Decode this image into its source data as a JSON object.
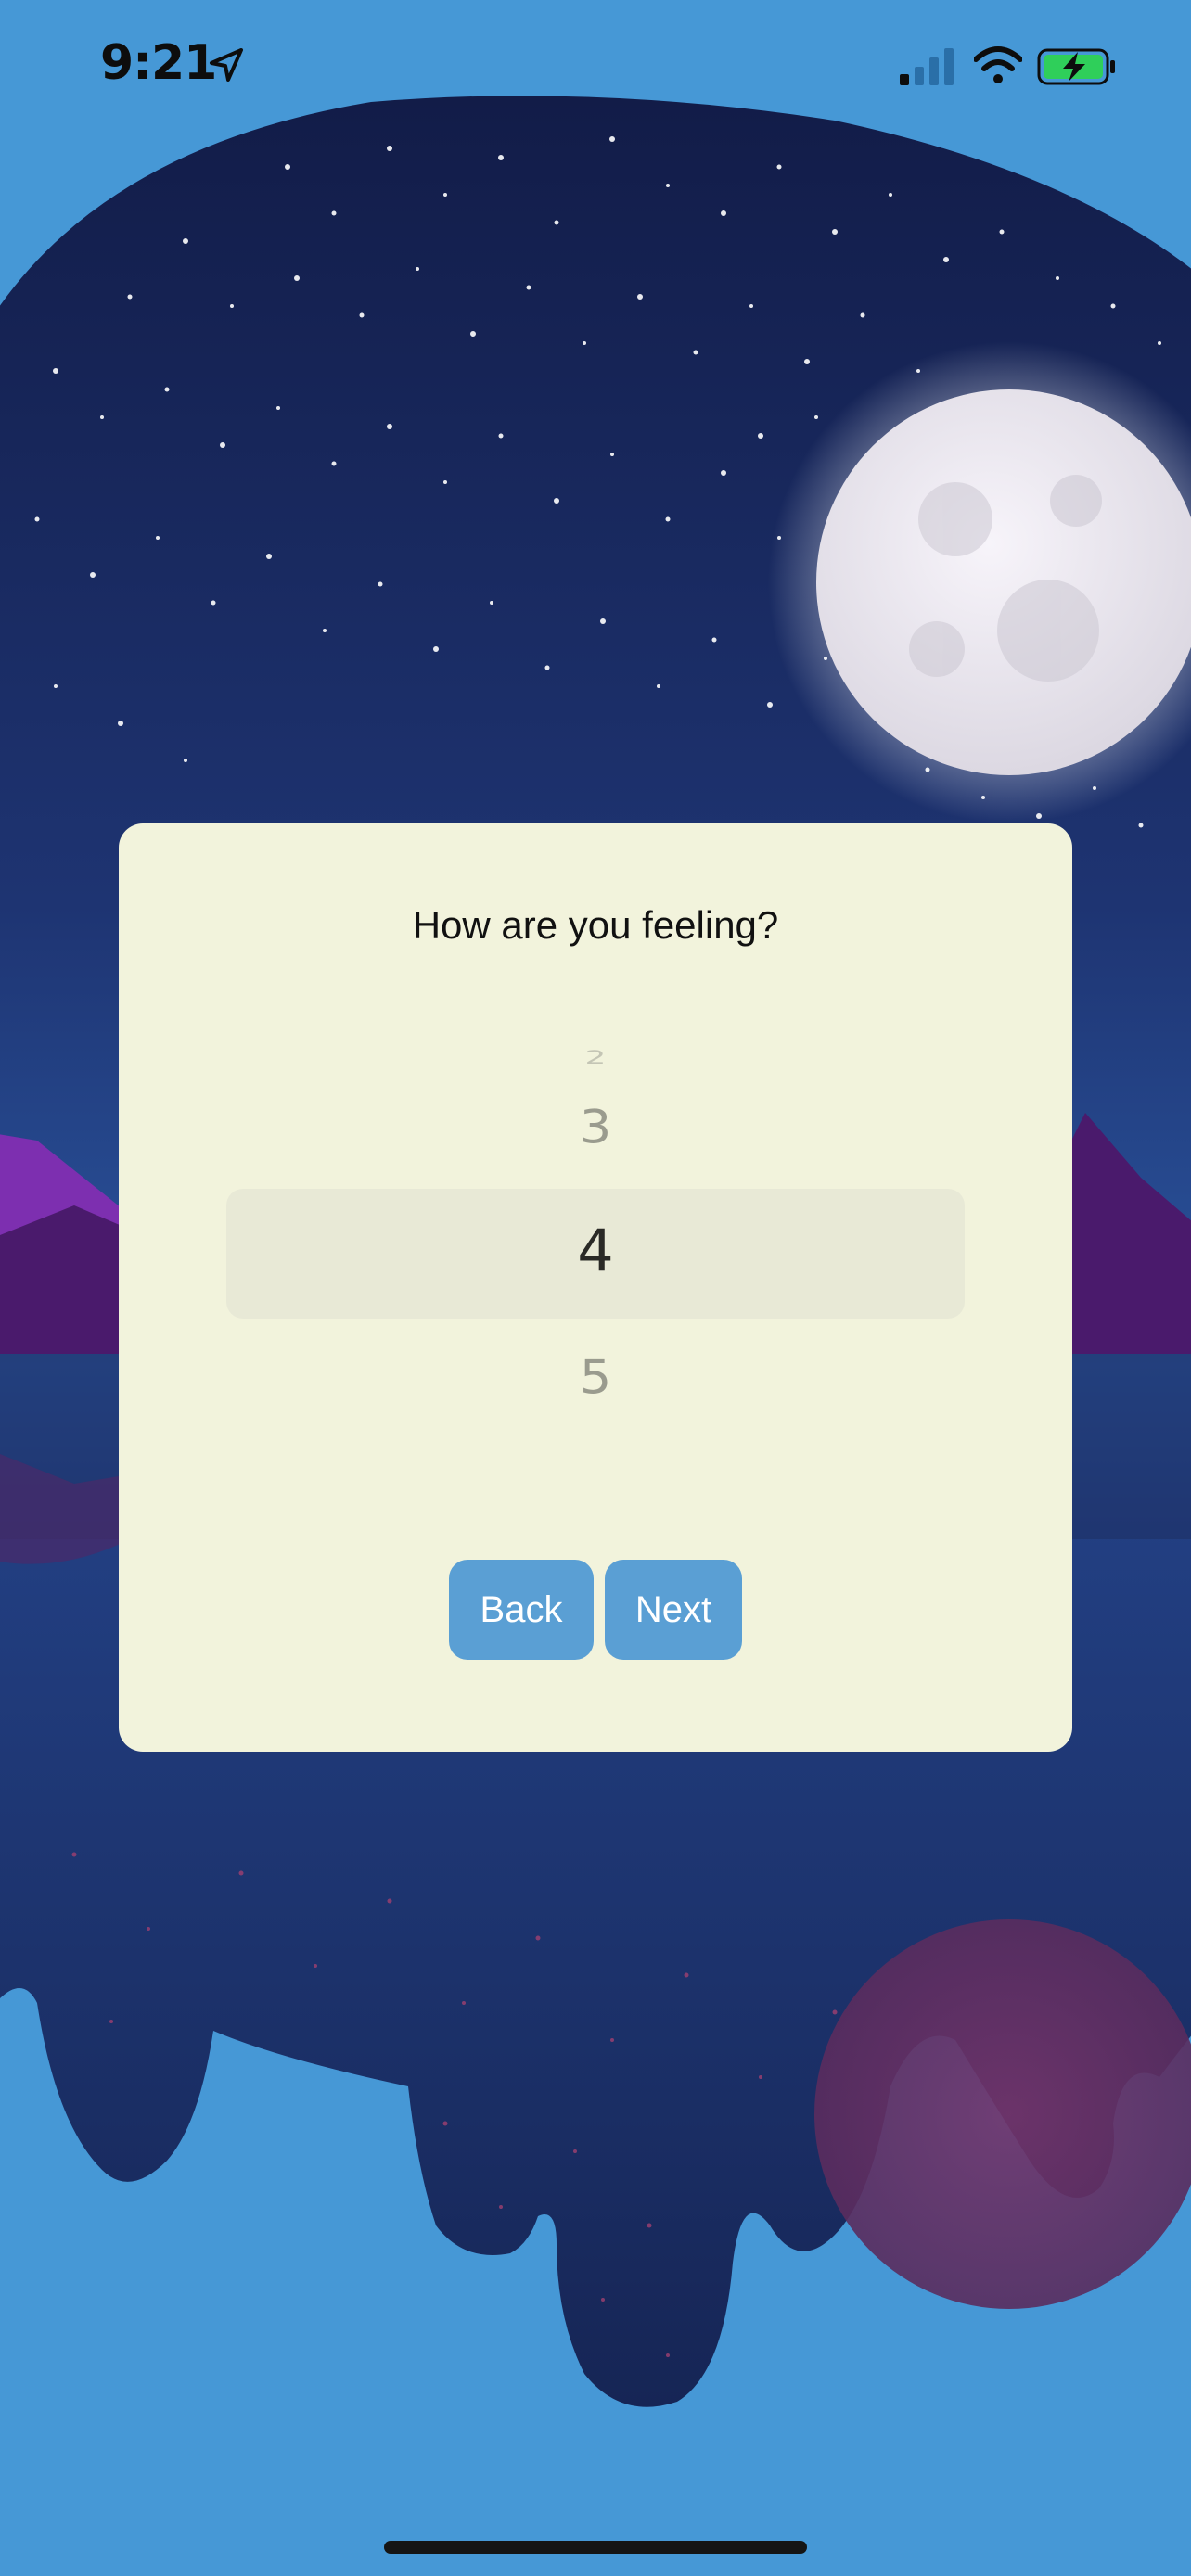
{
  "status_bar": {
    "time": "9:21",
    "icons": [
      "location-arrow-icon",
      "cellular-signal-icon",
      "wifi-icon",
      "battery-charging-icon"
    ]
  },
  "scene": {
    "description_icons": [
      "moon-icon",
      "stars-icon",
      "mountains-icon"
    ],
    "colors": {
      "background": "#4698d6",
      "sky_dark": "#121c48",
      "sky_light": "#2b56a0",
      "moon": "#ece8f0",
      "mountain_purple": "#7d2fb0",
      "reflection_pink": "#6a3466"
    }
  },
  "dialog": {
    "title": "How are you feeling?",
    "picker": {
      "options": [
        "2",
        "3",
        "4",
        "5"
      ],
      "selected": "4"
    },
    "buttons": {
      "back_label": "Back",
      "next_label": "Next"
    },
    "colors": {
      "card": "#f2f3dc",
      "button": "#5a9fd4"
    }
  }
}
